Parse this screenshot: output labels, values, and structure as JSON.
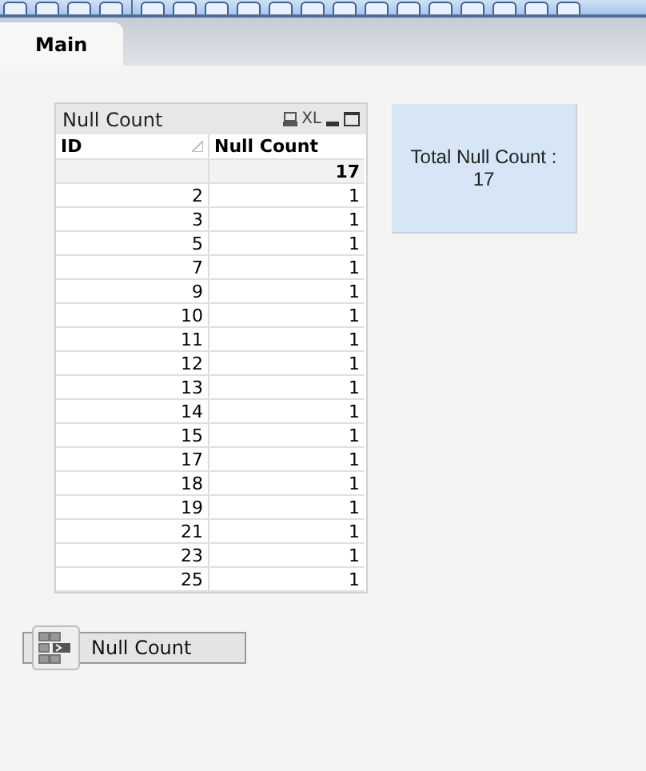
{
  "tabs": [
    {
      "label": "Main",
      "selected": true
    }
  ],
  "table": {
    "title": "Null Count",
    "xl_label": "XL",
    "columns": [
      "ID",
      "Null Count"
    ],
    "total": "17",
    "rows": [
      [
        "2",
        "1"
      ],
      [
        "3",
        "1"
      ],
      [
        "5",
        "1"
      ],
      [
        "7",
        "1"
      ],
      [
        "9",
        "1"
      ],
      [
        "10",
        "1"
      ],
      [
        "11",
        "1"
      ],
      [
        "12",
        "1"
      ],
      [
        "13",
        "1"
      ],
      [
        "14",
        "1"
      ],
      [
        "15",
        "1"
      ],
      [
        "17",
        "1"
      ],
      [
        "18",
        "1"
      ],
      [
        "19",
        "1"
      ],
      [
        "21",
        "1"
      ],
      [
        "23",
        "1"
      ],
      [
        "25",
        "1"
      ]
    ]
  },
  "text_box": {
    "lines": [
      "Total Null Count :",
      "17"
    ]
  },
  "button": {
    "label": "Null Count"
  }
}
